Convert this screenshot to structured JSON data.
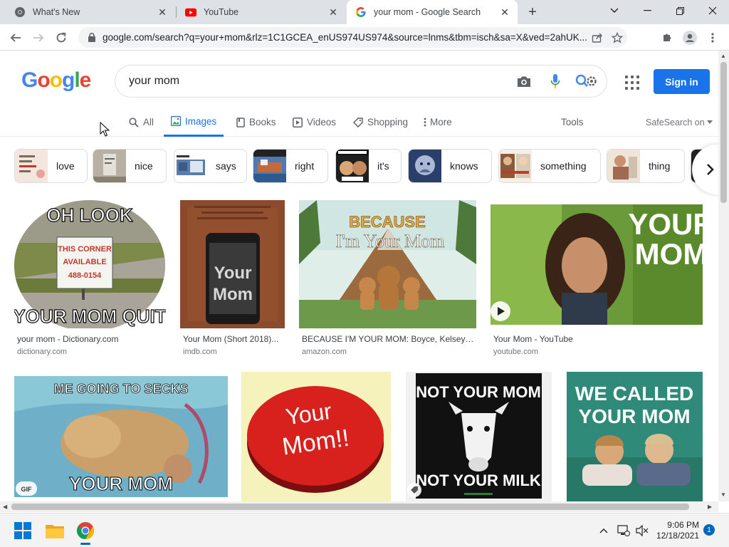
{
  "browser": {
    "tabs": [
      {
        "title": "What's New",
        "icon": "chrome-icon"
      },
      {
        "title": "YouTube",
        "icon": "youtube-icon"
      },
      {
        "title": "your mom - Google Search",
        "icon": "google-icon",
        "active": true
      }
    ],
    "url": "google.com/search?q=your+mom&rlz=1C1GCEA_enUS974US974&source=lnms&tbm=isch&sa=X&ved=2ahUK..."
  },
  "google": {
    "logo": "Google",
    "query": "your mom",
    "sign_in": "Sign in",
    "search_tabs": [
      {
        "label": "All",
        "icon": "search-icon"
      },
      {
        "label": "Images",
        "icon": "image-icon",
        "active": true
      },
      {
        "label": "Books",
        "icon": "book-icon"
      },
      {
        "label": "Videos",
        "icon": "video-icon"
      },
      {
        "label": "Shopping",
        "icon": "tag-icon"
      },
      {
        "label": "More",
        "icon": "more-vert-icon"
      }
    ],
    "tools": "Tools",
    "safesearch": "SafeSearch on",
    "chips": [
      "love",
      "nice",
      "says",
      "right",
      "it's",
      "knows",
      "something",
      "thing"
    ],
    "results": [
      {
        "title": "your mom - Dictionary.com",
        "source": "dictionary.com",
        "image_text": [
          "OH LOOK",
          "THIS CORNER",
          "AVAILABLE",
          "488-0154",
          "YOUR MOM QUIT"
        ]
      },
      {
        "title": "Your Mom (Short 2018)...",
        "source": "imdb.com",
        "image_text": [
          "Your",
          "Mom"
        ]
      },
      {
        "title": "BECAUSE I'M YOUR MOM: Boyce, Kelsey J...",
        "source": "amazon.com",
        "image_text": [
          "BECAUSE",
          "I'm Your Mom"
        ]
      },
      {
        "title": "Your Mom - YouTube",
        "source": "youtube.com",
        "image_text": [
          "YOUR",
          "MOM"
        ]
      },
      {
        "title": "",
        "source": "",
        "image_text": [
          "ME GOING TO SECKS",
          "YOUR MOM"
        ],
        "badge": "GIF"
      },
      {
        "title": "",
        "source": "",
        "image_text": [
          "Your",
          "Mom!!"
        ]
      },
      {
        "title": "",
        "source": "",
        "image_text": [
          "NOT YOUR MOM",
          "NOT YOUR MILK"
        ]
      },
      {
        "title": "",
        "source": "",
        "image_text": [
          "WE CALLED",
          "YOUR MOM"
        ]
      }
    ]
  },
  "taskbar": {
    "time": "9:06 PM",
    "date": "12/18/2021",
    "notifications": "1"
  },
  "colors": {
    "accent": "#1a73e8",
    "tabstrip": "#dee1e6"
  }
}
